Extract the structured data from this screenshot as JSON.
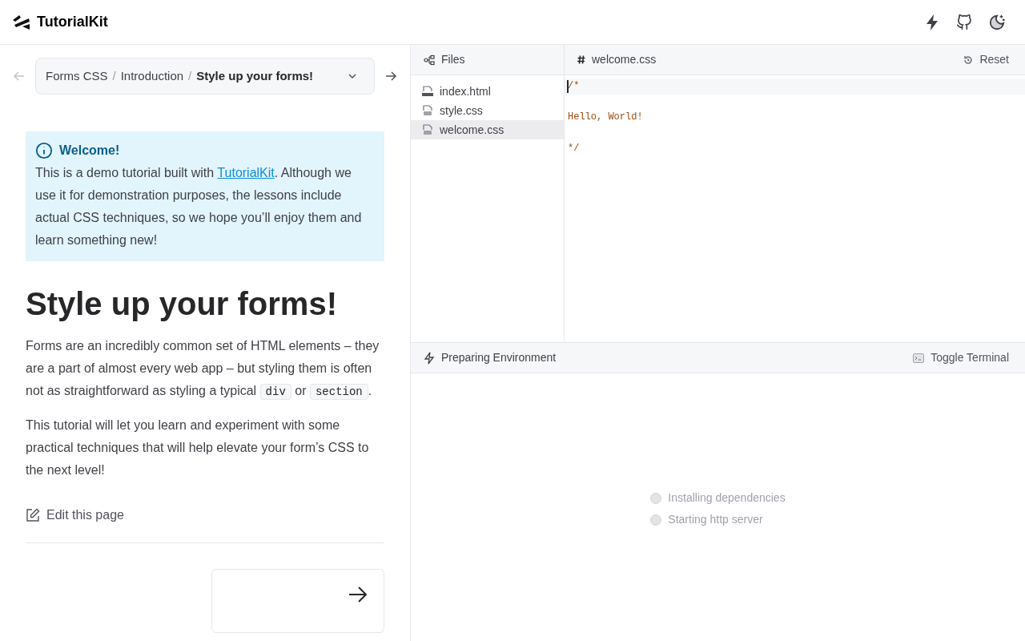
{
  "header": {
    "logo": "TutorialKit"
  },
  "breadcrumb": {
    "parts": [
      "Forms CSS",
      "Introduction",
      "Style up your forms!"
    ],
    "separator": "/"
  },
  "callout": {
    "title": "Welcome!",
    "before": "This is a demo tutorial built with ",
    "link": "TutorialKit",
    "after": ". Although we use it for demonstration purposes, the lessons include actual CSS techniques, so we hope you’ll enjoy them and learn something new!"
  },
  "heading": "Style up your forms!",
  "paragraphs": [
    [
      {
        "kind": "text",
        "text": "Forms are an incredibly common set of HTML elements – they are a part of almost every web app – but styling them is often not as straightforward as styling a typical "
      },
      {
        "kind": "code",
        "text": "div"
      },
      {
        "kind": "text",
        "text": " or "
      },
      {
        "kind": "code",
        "text": "section"
      },
      {
        "kind": "text",
        "text": "."
      }
    ],
    [
      {
        "kind": "text",
        "text": "This tutorial will let you learn and experiment with some practical techniques that will help elevate your form’s CSS to the next level!"
      }
    ]
  ],
  "edit_link": "Edit this page",
  "files": {
    "title": "Files",
    "items": [
      {
        "name": "index.html",
        "kind": "html",
        "selected": false
      },
      {
        "name": "style.css",
        "kind": "css",
        "selected": false
      },
      {
        "name": "welcome.css",
        "kind": "css",
        "selected": true
      }
    ]
  },
  "editor": {
    "tab": "welcome.css",
    "reset": "Reset",
    "code": "/*\n\nHello, World!\n\n*/"
  },
  "terminal": {
    "title": "Preparing Environment",
    "toggle": "Toggle Terminal",
    "steps": [
      {
        "label": "Installing dependencies",
        "done": false
      },
      {
        "label": "Starting http server",
        "done": false
      }
    ]
  }
}
